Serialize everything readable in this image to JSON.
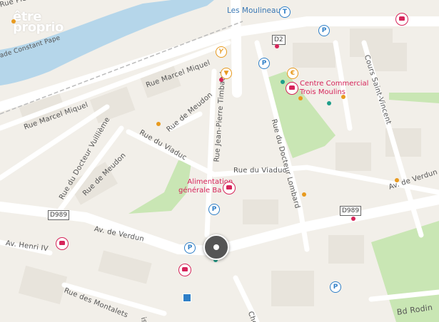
{
  "logo": {
    "line1": "être",
    "line2": "proprio"
  },
  "streets": {
    "pierre_poli": "Rue Pierre Poli",
    "constant_pape": "ade Constant Pape",
    "marcel_miquel_1": "Rue Marcel Miquel",
    "marcel_miquel_2": "Rue Marcel Miquel",
    "meudon_1": "Rue de Meudon",
    "meudon_2": "Rue de Meudon",
    "viaduc_1": "Rue du Viaduc",
    "viaduc_2": "Rue du Viaduc",
    "timbaud": "Rue Jean-Pierre Timbaud",
    "docteur_lombard": "Rue du Docteur Lombard",
    "docteur_vuillieme": "Rue du Docteur Vuillième",
    "saint_vincent": "Cours Saint-Vincent",
    "verdun_1": "Av. de Verdun",
    "verdun_2": "Av. de Verdun",
    "henri_iv": "Av. Henri IV",
    "montalets": "Rue des Montalets",
    "bd_rodin": "Bd Rodin",
    "chemin": "Chemi",
    "fragment_is": "is"
  },
  "places": {
    "moulineaux": "Les Moulineaux",
    "centre_line1": "Centre Commercial",
    "centre_line2": "Trois Moulins",
    "alim_line1": "Alimentation",
    "alim_line2": "générale Ba Pri"
  },
  "shields": {
    "d2": "D2",
    "d989_left": "D989",
    "d989_right": "D989"
  },
  "icons": {
    "parking": "P",
    "tram": "T",
    "euro": "€",
    "restaurant": "fork-knife",
    "bar": "cocktail"
  },
  "colors": {
    "water": "#b5d6ea",
    "park": "#c9e6b4",
    "road": "#ffffff",
    "poi_red": "#d6245a",
    "poi_orange": "#e89a1e",
    "transit_blue": "#2f7fc7",
    "teal": "#1e9e8a"
  }
}
